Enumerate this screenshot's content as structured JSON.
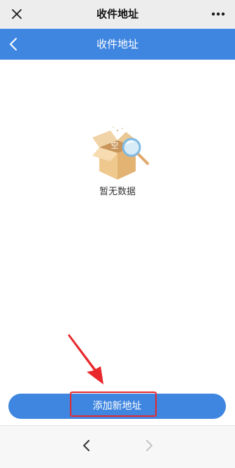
{
  "wechat_bar": {
    "title": "收件地址",
    "close_icon": "close-icon",
    "more_icon": "more-icon"
  },
  "app_bar": {
    "title": "收件地址",
    "back_icon": "chevron-left-icon",
    "background_color": "#3f86e0"
  },
  "empty_state": {
    "box_label": "空",
    "message": "暂无数据"
  },
  "actions": {
    "add_address_label": "添加新地址",
    "button_color": "#3f86e0",
    "highlight_color": "#e8282b"
  },
  "browser_nav": {
    "back_icon": "chevron-left-icon",
    "forward_icon": "chevron-right-icon"
  }
}
